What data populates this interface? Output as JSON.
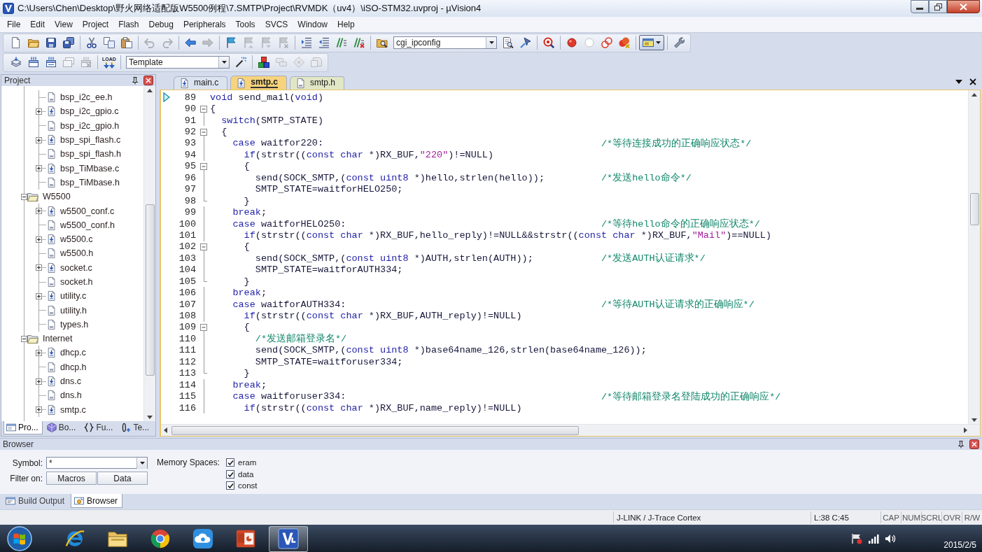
{
  "window": {
    "title": "C:\\Users\\Chen\\Desktop\\野火网络适配版W5500例程\\7.SMTP\\Project\\RVMDK（uv4）\\iSO-STM32.uvproj - µVision4"
  },
  "menu": [
    "File",
    "Edit",
    "View",
    "Project",
    "Flash",
    "Debug",
    "Peripherals",
    "Tools",
    "SVCS",
    "Window",
    "Help"
  ],
  "toolbars": [
    {
      "groups": [
        [
          {
            "kind": "new",
            "disabled": false
          },
          {
            "kind": "open",
            "disabled": false
          },
          {
            "kind": "save",
            "disabled": false
          },
          {
            "kind": "save-all",
            "disabled": false
          }
        ],
        [
          {
            "kind": "cut",
            "disabled": false
          },
          {
            "kind": "copy",
            "disabled": false
          },
          {
            "kind": "paste",
            "disabled": false
          }
        ],
        [
          {
            "kind": "undo",
            "disabled": true
          },
          {
            "kind": "redo",
            "disabled": true
          }
        ],
        [
          {
            "kind": "back",
            "disabled": false
          },
          {
            "kind": "forward",
            "disabled": true
          }
        ],
        [
          {
            "kind": "bookmark",
            "disabled": false
          },
          {
            "kind": "prev-bookmark",
            "disabled": true
          },
          {
            "kind": "next-bookmark",
            "disabled": true
          },
          {
            "kind": "clear-bookmarks",
            "disabled": true
          }
        ],
        [
          {
            "kind": "indent",
            "disabled": false
          },
          {
            "kind": "outdent",
            "disabled": false
          },
          {
            "kind": "comment",
            "disabled": false
          },
          {
            "kind": "uncomment",
            "disabled": false
          }
        ],
        [
          {
            "kind": "find-in-files",
            "disabled": false
          },
          {
            "kind": "find-combo",
            "value": "cgi_ipconfig",
            "disabled": false
          },
          {
            "kind": "find",
            "disabled": false
          },
          {
            "kind": "incremental-find",
            "disabled": false
          }
        ],
        [
          {
            "kind": "debug",
            "disabled": false
          }
        ],
        [
          {
            "kind": "breakpoint",
            "disabled": false
          },
          {
            "kind": "toggle-breakpoint",
            "disabled": false
          },
          {
            "kind": "disable-breakpoints",
            "disabled": false
          },
          {
            "kind": "kill-breakpoints",
            "disabled": false
          }
        ],
        [
          {
            "kind": "window-menu",
            "disabled": false
          }
        ],
        [
          {
            "kind": "configure",
            "disabled": false
          }
        ]
      ]
    },
    {
      "groups": [
        [
          {
            "kind": "translate",
            "disabled": false
          },
          {
            "kind": "build",
            "disabled": false
          },
          {
            "kind": "rebuild",
            "disabled": false
          },
          {
            "kind": "batch-build",
            "disabled": true
          },
          {
            "kind": "stop-build",
            "disabled": true
          }
        ],
        [
          {
            "kind": "download",
            "label": "LOAD",
            "disabled": false
          }
        ],
        [
          {
            "kind": "target-combo",
            "value": "Template",
            "disabled": false
          },
          {
            "kind": "options",
            "disabled": false
          }
        ],
        [
          {
            "kind": "manage",
            "disabled": false
          },
          {
            "kind": "components",
            "disabled": true
          },
          {
            "kind": "environment",
            "disabled": true
          },
          {
            "kind": "books",
            "disabled": true
          }
        ]
      ]
    }
  ],
  "project_panel": {
    "title": "Project",
    "tree": {
      "continued_files": [
        {
          "label": "bsp_i2c_ee.h",
          "kind": "header"
        },
        {
          "label": "bsp_i2c_gpio.c",
          "kind": "source"
        },
        {
          "label": "bsp_i2c_gpio.h",
          "kind": "header"
        },
        {
          "label": "bsp_spi_flash.c",
          "kind": "source"
        },
        {
          "label": "bsp_spi_flash.h",
          "kind": "header"
        },
        {
          "label": "bsp_TiMbase.c",
          "kind": "source"
        },
        {
          "label": "bsp_TiMbase.h",
          "kind": "header"
        }
      ],
      "groups": [
        {
          "label": "W5500",
          "expanded": true,
          "children": [
            {
              "label": "w5500_conf.c",
              "kind": "source"
            },
            {
              "label": "w5500_conf.h",
              "kind": "header"
            },
            {
              "label": "w5500.c",
              "kind": "source"
            },
            {
              "label": "w5500.h",
              "kind": "header"
            },
            {
              "label": "socket.c",
              "kind": "source"
            },
            {
              "label": "socket.h",
              "kind": "header"
            },
            {
              "label": "utility.c",
              "kind": "source"
            },
            {
              "label": "utility.h",
              "kind": "header"
            },
            {
              "label": "types.h",
              "kind": "header"
            }
          ]
        },
        {
          "label": "Internet",
          "expanded": true,
          "children": [
            {
              "label": "dhcp.c",
              "kind": "source"
            },
            {
              "label": "dhcp.h",
              "kind": "header"
            },
            {
              "label": "dns.c",
              "kind": "source"
            },
            {
              "label": "dns.h",
              "kind": "header"
            },
            {
              "label": "smtp.c",
              "kind": "source"
            }
          ]
        }
      ]
    },
    "tabs": [
      {
        "label": "Pro...",
        "kind": "project",
        "selected": true
      },
      {
        "label": "Bo...",
        "kind": "books",
        "selected": false
      },
      {
        "label": "Fu...",
        "kind": "functions",
        "selected": false
      },
      {
        "label": "Te...",
        "kind": "templates",
        "selected": false
      }
    ]
  },
  "editor": {
    "tabs": [
      {
        "label": "main.c",
        "kind": "source",
        "selected": false,
        "color": "#dce3f0"
      },
      {
        "label": "smtp.c",
        "kind": "source",
        "selected": true,
        "color": "#f6d37c"
      },
      {
        "label": "smtp.h",
        "kind": "header",
        "selected": false,
        "color": "#e1e6c6"
      }
    ],
    "lines": [
      {
        "number": "89",
        "kind": "no-fold",
        "current": true,
        "tokens": [
          {
            "kind": "keyword",
            "text": "void"
          },
          {
            "kind": "plain",
            "text": " send_mail("
          },
          {
            "kind": "keyword",
            "text": "void"
          },
          {
            "kind": "plain",
            "text": ")"
          }
        ]
      },
      {
        "number": "90",
        "kind": "fold-start",
        "current": false,
        "tokens": [
          {
            "kind": "plain",
            "text": "{"
          }
        ]
      },
      {
        "number": "91",
        "kind": "fold-body",
        "current": false,
        "tokens": [
          {
            "kind": "keyword",
            "text": "  switch"
          },
          {
            "kind": "plain",
            "text": "(SMTP_STATE)"
          }
        ]
      },
      {
        "number": "92",
        "kind": "fold-start",
        "current": false,
        "tokens": [
          {
            "kind": "plain",
            "text": "  {"
          }
        ]
      },
      {
        "number": "93",
        "kind": "fold-body",
        "current": false,
        "tokens": [
          {
            "kind": "keyword",
            "text": "    case"
          },
          {
            "kind": "plain",
            "text": " waitfor220:"
          }
        ],
        "comment": "/*等待连接成功的正确响应状态*/"
      },
      {
        "number": "94",
        "kind": "fold-body",
        "current": false,
        "tokens": [
          {
            "kind": "keyword",
            "text": "      if"
          },
          {
            "kind": "plain",
            "text": "(strstr(("
          },
          {
            "kind": "keyword",
            "text": "const char"
          },
          {
            "kind": "plain",
            "text": " *)RX_BUF,"
          },
          {
            "kind": "string",
            "text": "\"220\""
          },
          {
            "kind": "plain",
            "text": ")!=NULL)"
          }
        ]
      },
      {
        "number": "95",
        "kind": "fold-start",
        "current": false,
        "tokens": [
          {
            "kind": "plain",
            "text": "      {"
          }
        ]
      },
      {
        "number": "96",
        "kind": "fold-body",
        "current": false,
        "tokens": [
          {
            "kind": "plain",
            "text": "        send(SOCK_SMTP,("
          },
          {
            "kind": "keyword",
            "text": "const uint8"
          },
          {
            "kind": "plain",
            "text": " *)hello,strlen(hello));"
          }
        ],
        "comment": "/*发送hello命令*/"
      },
      {
        "number": "97",
        "kind": "fold-body",
        "current": false,
        "tokens": [
          {
            "kind": "plain",
            "text": "        SMTP_STATE=waitforHELO250;"
          }
        ]
      },
      {
        "number": "98",
        "kind": "fold-end",
        "current": false,
        "tokens": [
          {
            "kind": "plain",
            "text": "      }"
          }
        ]
      },
      {
        "number": "99",
        "kind": "fold-body",
        "current": false,
        "tokens": [
          {
            "kind": "keyword",
            "text": "    break"
          },
          {
            "kind": "plain",
            "text": ";"
          }
        ]
      },
      {
        "number": "100",
        "kind": "fold-body",
        "current": false,
        "tokens": [
          {
            "kind": "keyword",
            "text": "    case"
          },
          {
            "kind": "plain",
            "text": " waitforHELO250:"
          }
        ],
        "comment": "/*等待hello命令的正确响应状态*/"
      },
      {
        "number": "101",
        "kind": "fold-body",
        "current": false,
        "tokens": [
          {
            "kind": "keyword",
            "text": "      if"
          },
          {
            "kind": "plain",
            "text": "(strstr(("
          },
          {
            "kind": "keyword",
            "text": "const char"
          },
          {
            "kind": "plain",
            "text": " *)RX_BUF,hello_reply)!=NULL&&strstr(("
          },
          {
            "kind": "keyword",
            "text": "const char"
          },
          {
            "kind": "plain",
            "text": " *)RX_BUF,"
          },
          {
            "kind": "string",
            "text": "\"Mail\""
          },
          {
            "kind": "plain",
            "text": ")==NULL)"
          }
        ]
      },
      {
        "number": "102",
        "kind": "fold-start",
        "current": false,
        "tokens": [
          {
            "kind": "plain",
            "text": "      {"
          }
        ]
      },
      {
        "number": "103",
        "kind": "fold-body",
        "current": false,
        "tokens": [
          {
            "kind": "plain",
            "text": "        send(SOCK_SMTP,("
          },
          {
            "kind": "keyword",
            "text": "const uint8"
          },
          {
            "kind": "plain",
            "text": " *)AUTH,strlen(AUTH));"
          }
        ],
        "comment": "/*发送AUTH认证请求*/"
      },
      {
        "number": "104",
        "kind": "fold-body",
        "current": false,
        "tokens": [
          {
            "kind": "plain",
            "text": "        SMTP_STATE=waitforAUTH334;"
          }
        ]
      },
      {
        "number": "105",
        "kind": "fold-end",
        "current": false,
        "tokens": [
          {
            "kind": "plain",
            "text": "      }"
          }
        ]
      },
      {
        "number": "106",
        "kind": "fold-body",
        "current": false,
        "tokens": [
          {
            "kind": "keyword",
            "text": "    break"
          },
          {
            "kind": "plain",
            "text": ";"
          }
        ]
      },
      {
        "number": "107",
        "kind": "fold-body",
        "current": false,
        "tokens": [
          {
            "kind": "keyword",
            "text": "    case"
          },
          {
            "kind": "plain",
            "text": " waitforAUTH334:"
          }
        ],
        "comment": "/*等待AUTH认证请求的正确响应*/"
      },
      {
        "number": "108",
        "kind": "fold-body",
        "current": false,
        "tokens": [
          {
            "kind": "keyword",
            "text": "      if"
          },
          {
            "kind": "plain",
            "text": "(strstr(("
          },
          {
            "kind": "keyword",
            "text": "const char"
          },
          {
            "kind": "plain",
            "text": " *)RX_BUF,AUTH_reply)!=NULL)"
          }
        ]
      },
      {
        "number": "109",
        "kind": "fold-start",
        "current": false,
        "tokens": [
          {
            "kind": "plain",
            "text": "      {"
          }
        ]
      },
      {
        "number": "110",
        "kind": "fold-body",
        "current": false,
        "tokens": [
          {
            "kind": "comment",
            "text": "        /*发送邮箱登录名*/"
          }
        ]
      },
      {
        "number": "111",
        "kind": "fold-body",
        "current": false,
        "tokens": [
          {
            "kind": "plain",
            "text": "        send(SOCK_SMTP,("
          },
          {
            "kind": "keyword",
            "text": "const uint8"
          },
          {
            "kind": "plain",
            "text": " *)base64name_126,strlen(base64name_126));"
          }
        ]
      },
      {
        "number": "112",
        "kind": "fold-body",
        "current": false,
        "tokens": [
          {
            "kind": "plain",
            "text": "        SMTP_STATE=waitforuser334;"
          }
        ]
      },
      {
        "number": "113",
        "kind": "fold-end",
        "current": false,
        "tokens": [
          {
            "kind": "plain",
            "text": "      }"
          }
        ]
      },
      {
        "number": "114",
        "kind": "fold-body",
        "current": false,
        "tokens": [
          {
            "kind": "keyword",
            "text": "    break"
          },
          {
            "kind": "plain",
            "text": ";"
          }
        ]
      },
      {
        "number": "115",
        "kind": "fold-body",
        "current": false,
        "tokens": [
          {
            "kind": "keyword",
            "text": "    case"
          },
          {
            "kind": "plain",
            "text": " waitforuser334:"
          }
        ],
        "comment": "/*等待邮箱登录名登陆成功的正确响应*/"
      },
      {
        "number": "116",
        "kind": "fold-body",
        "current": false,
        "tokens": [
          {
            "kind": "keyword",
            "text": "      if"
          },
          {
            "kind": "plain",
            "text": "(strstr(("
          },
          {
            "kind": "keyword",
            "text": "const char"
          },
          {
            "kind": "plain",
            "text": " *)RX_BUF,name_reply)!=NULL)"
          }
        ]
      }
    ]
  },
  "browser_panel": {
    "title": "Browser",
    "symbol": {
      "label": "Symbol:",
      "value": "*"
    },
    "filter": {
      "label": "Filter on:",
      "buttons": [
        "Macros",
        "Data"
      ]
    },
    "memory_spaces": {
      "label": "Memory Spaces:",
      "options": [
        {
          "label": "eram",
          "checked": true
        },
        {
          "label": "data",
          "checked": true
        },
        {
          "label": "const",
          "checked": true
        }
      ]
    }
  },
  "output_tabs": [
    {
      "label": "Build Output",
      "kind": "build-output",
      "selected": false
    },
    {
      "label": "Browser",
      "kind": "browser",
      "selected": true
    }
  ],
  "status_bar": {
    "debugger": "J-LINK / J-Trace Cortex",
    "position": "L:38 C:45",
    "indicators": [
      "CAP",
      "NUM",
      "SCRL",
      "OVR",
      "R/W"
    ]
  },
  "taskbar": {
    "apps": [
      {
        "kind": "web-browser",
        "selected": false
      },
      {
        "kind": "file-manager",
        "selected": false
      },
      {
        "kind": "ring-browser",
        "selected": false
      },
      {
        "kind": "cloud",
        "selected": false
      },
      {
        "kind": "slides",
        "selected": false
      },
      {
        "kind": "ide",
        "selected": true
      }
    ],
    "date": "2015/2/5"
  }
}
